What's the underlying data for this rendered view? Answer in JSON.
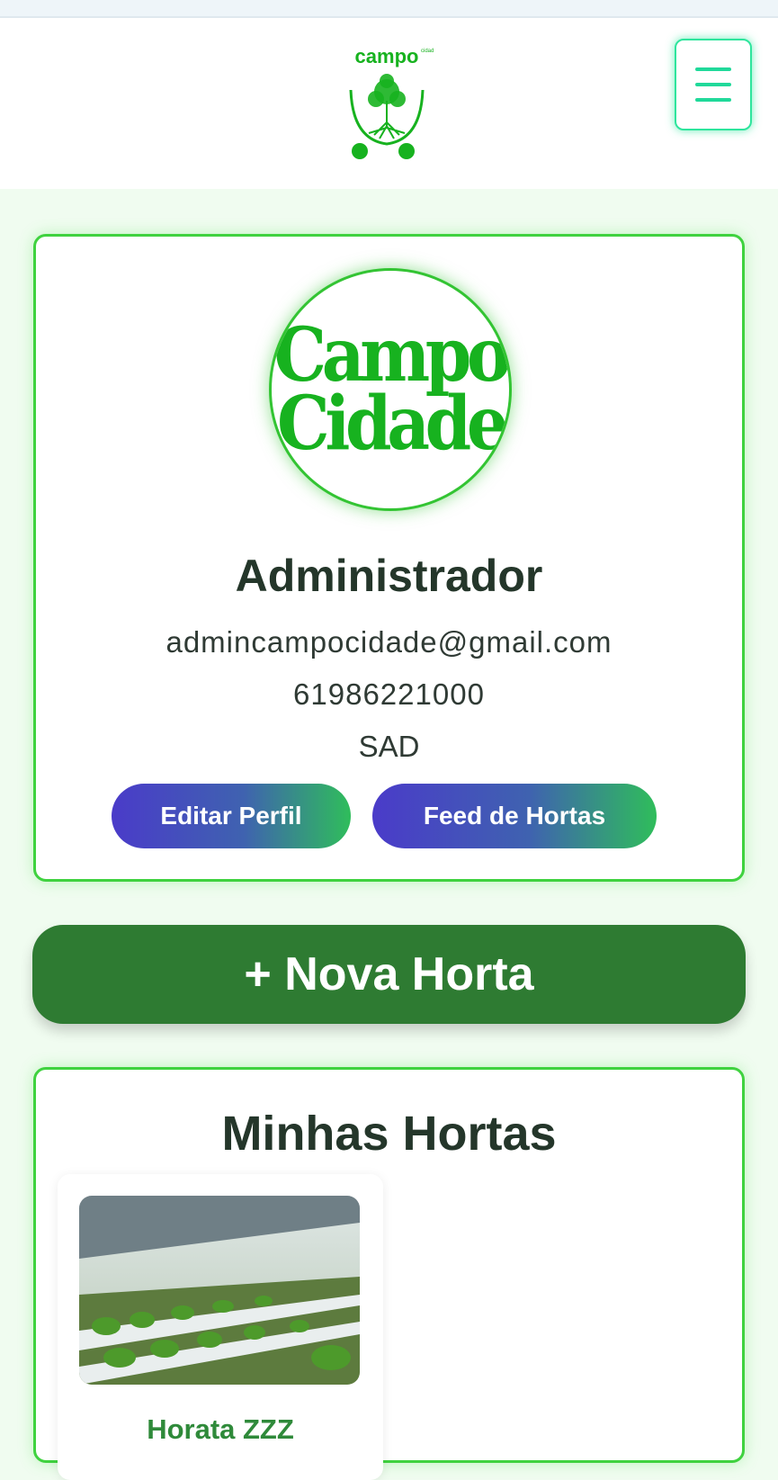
{
  "header": {
    "logo_text": "campo",
    "logo_small_text": "cidade",
    "menu_icon": "hamburger-icon"
  },
  "profile": {
    "avatar_text_line1": "Campo",
    "avatar_text_line2": "Cidade",
    "name": "Administrador",
    "email": "admincampocidade@gmail.com",
    "phone": "61986221000",
    "region": "SAD",
    "edit_button": "Editar Perfil",
    "feed_button": "Feed de Hortas"
  },
  "actions": {
    "new_garden_button": "+ Nova Horta"
  },
  "gardens": {
    "title": "Minhas Hortas",
    "items": [
      {
        "name": "Horata ZZZ"
      }
    ]
  },
  "colors": {
    "accent_green": "#3fd23f",
    "menu_accent": "#2ee59d",
    "primary_button": "#2e7b32",
    "gradient_start": "#4a3bc9",
    "gradient_end": "#2fbd5b"
  }
}
